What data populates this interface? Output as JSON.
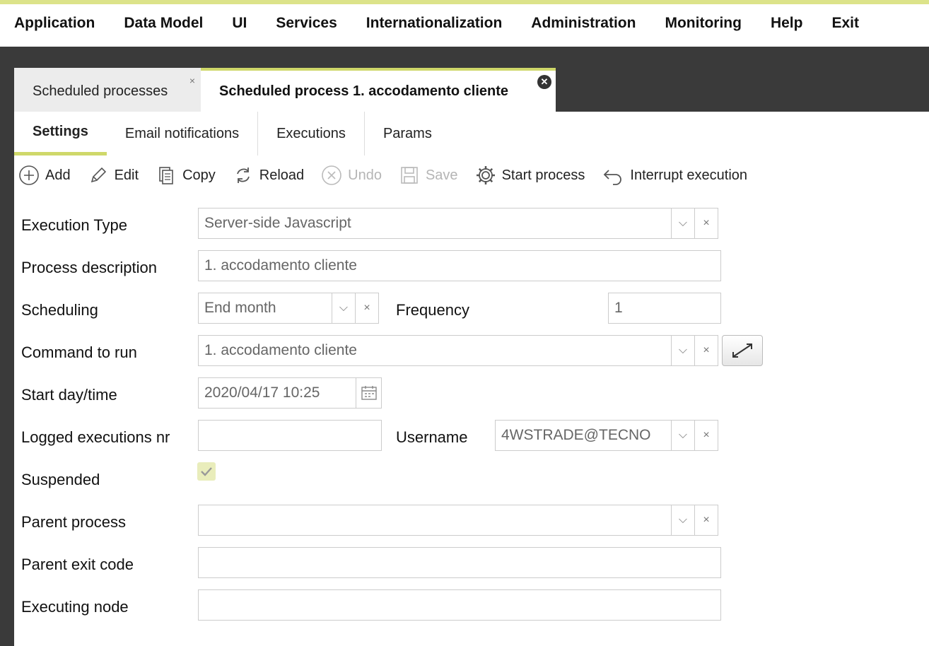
{
  "menu": [
    "Application",
    "Data Model",
    "UI",
    "Services",
    "Internationalization",
    "Administration",
    "Monitoring",
    "Help",
    "Exit"
  ],
  "tabs": [
    {
      "label": "Scheduled processes"
    },
    {
      "label": "Scheduled process 1. accodamento cliente"
    }
  ],
  "subtabs": [
    "Settings",
    "Email notifications",
    "Executions",
    "Params"
  ],
  "toolbar": {
    "add": "Add",
    "edit": "Edit",
    "copy": "Copy",
    "reload": "Reload",
    "undo": "Undo",
    "save": "Save",
    "start": "Start process",
    "interrupt": "Interrupt execution"
  },
  "form": {
    "execution_type_label": "Execution Type",
    "execution_type_value": "Server-side Javascript",
    "process_description_label": "Process description",
    "process_description_value": "1. accodamento cliente",
    "scheduling_label": "Scheduling",
    "scheduling_value": "End month",
    "frequency_label": "Frequency",
    "frequency_value": "1",
    "command_label": "Command to run",
    "command_value": "1. accodamento cliente",
    "start_label": "Start day/time",
    "start_value": "2020/04/17 10:25",
    "logged_label": "Logged executions nr",
    "logged_value": "",
    "username_label": "Username",
    "username_value": "4WSTRADE@TECNO",
    "suspended_label": "Suspended",
    "suspended_checked": true,
    "parent_process_label": "Parent process",
    "parent_process_value": "",
    "parent_exit_label": "Parent exit code",
    "parent_exit_value": "",
    "executing_node_label": "Executing node",
    "executing_node_value": ""
  }
}
